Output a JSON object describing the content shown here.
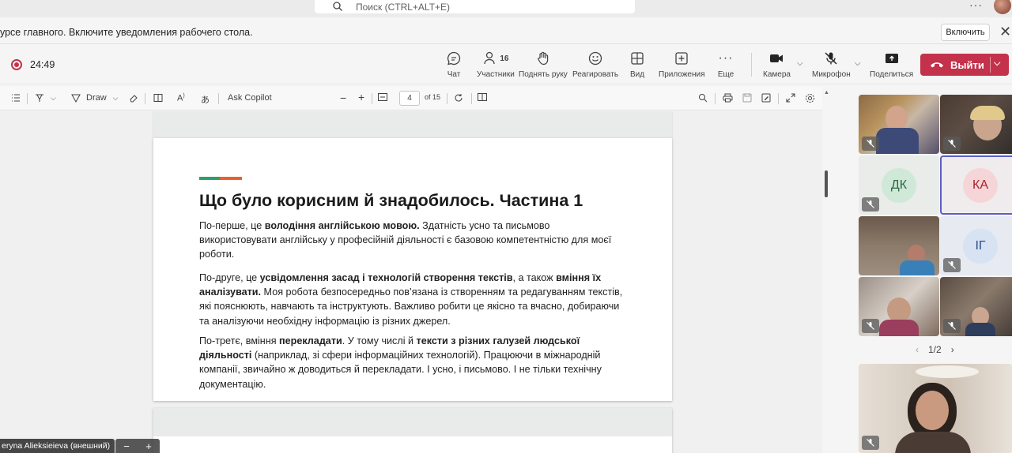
{
  "search": {
    "placeholder": "Поиск (CTRL+ALT+E)"
  },
  "notification": {
    "text": "урсе главного. Включите уведомления рабочего стола.",
    "button": "Включить"
  },
  "meeting": {
    "timer": "24:49",
    "participants_count": "16",
    "buttons": {
      "chat": "Чат",
      "participants": "Участники",
      "raise_hand": "Поднять руку",
      "react": "Реагировать",
      "view": "Вид",
      "apps": "Приложения",
      "more": "Еще",
      "camera": "Камера",
      "mic": "Микрофон",
      "share": "Поделиться",
      "leave": "Выйти"
    }
  },
  "pdf_toolbar": {
    "draw": "Draw",
    "ask_copilot": "Ask Copilot",
    "page_current": "4",
    "page_total": "of 15"
  },
  "document": {
    "title": "Що було корисним й знадобилось. Частина 1",
    "p1": [
      {
        "t": "По-перше, це ",
        "b": false
      },
      {
        "t": "володіння англійською мовою.",
        "b": true
      },
      {
        "t": " Здатність усно та письмово використовувати англійську у професійній діяльності є базовою компетентністю для моєї роботи.",
        "b": false
      }
    ],
    "p2": [
      {
        "t": "По-друге, це ",
        "b": false
      },
      {
        "t": "усвідомлення засад і технологій створення текстів",
        "b": true
      },
      {
        "t": ", а також ",
        "b": false
      },
      {
        "t": "вміння їх аналізувати.",
        "b": true
      },
      {
        "t": " Моя робота безпосередньо пов’язана із створенням та редагуванням текстів, які пояснюють, навчають та інструктують. Важливо робити це якісно та вчасно, добираючи та аналізуючи необхідну інформацію із різних джерел.",
        "b": false
      }
    ],
    "p3": [
      {
        "t": "По-третє, вміння ",
        "b": false
      },
      {
        "t": "перекладати",
        "b": true
      },
      {
        "t": ". У тому числі й ",
        "b": false
      },
      {
        "t": "тексти з різних галузей людської діяльності",
        "b": true
      },
      {
        "t": " (наприклад, зі сфери інформаційних технологій). Працюючи в міжнародній компанії, звичайно ж доводиться й перекладати. І усно, і письмово. І не тільки технічну документацію.",
        "b": false
      }
    ]
  },
  "gallery": {
    "initials": [
      "ДК",
      "КА",
      "ІГ"
    ],
    "pager": "1/2"
  },
  "presenter": {
    "name": "eryna Alieksieieva (внешний)"
  },
  "colors": {
    "leave_red": "#c4314b",
    "accent_green": "#2d9f6a",
    "accent_orange": "#e8612c"
  }
}
